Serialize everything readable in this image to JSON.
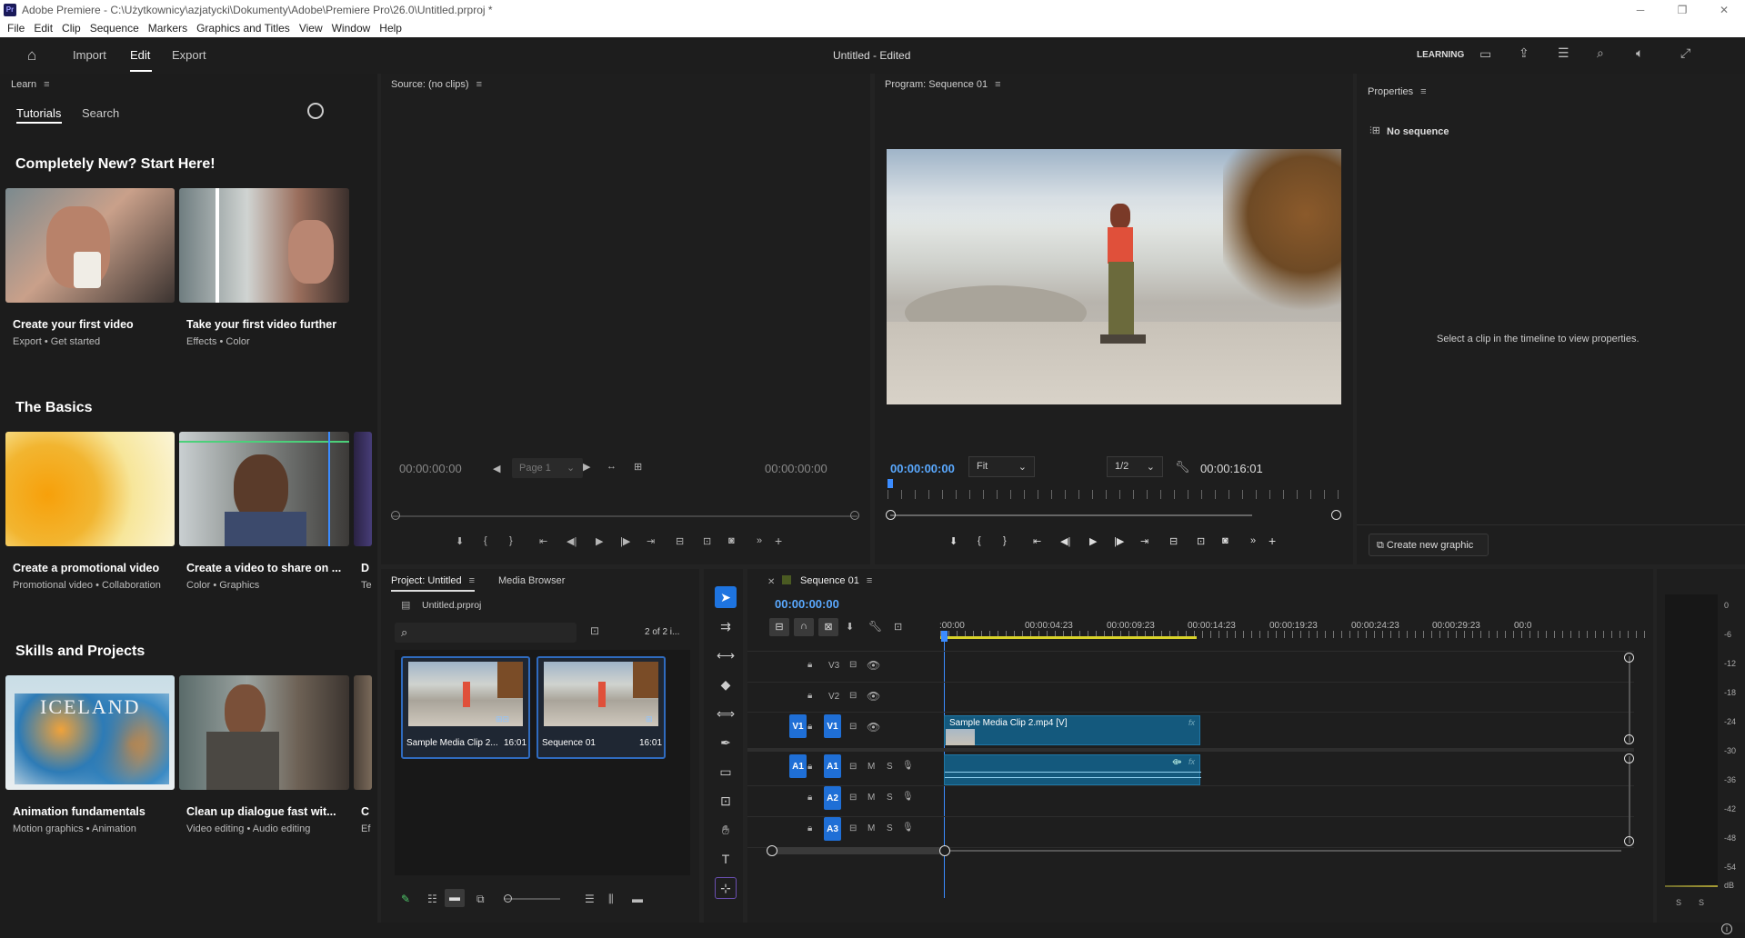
{
  "os_title": "Adobe Premiere - C:\\Użytkownicy\\azjatycki\\Dokumenty\\Adobe\\Premiere Pro\\26.0\\Untitled.prproj *",
  "menu": [
    "File",
    "Edit",
    "Clip",
    "Sequence",
    "Markers",
    "Graphics and Titles",
    "View",
    "Window",
    "Help"
  ],
  "header": {
    "nav": [
      "Import",
      "Edit",
      "Export"
    ],
    "active": "Edit",
    "project_status": "Untitled - Edited",
    "workspace": "LEARNING"
  },
  "learn": {
    "title": "Learn",
    "tabs": [
      "Tutorials",
      "Search"
    ],
    "sections": [
      {
        "heading": "Completely New? Start Here!",
        "cards": [
          {
            "title": "Create your first video",
            "sub": "Export  •  Get started"
          },
          {
            "title": "Take your first video further",
            "sub": "Effects  •  Color"
          }
        ]
      },
      {
        "heading": "The Basics",
        "cards": [
          {
            "title": "Create a promotional video",
            "sub": "Promotional video  •  Collaboration"
          },
          {
            "title": "Create a video to share on ...",
            "sub": "Color  •  Graphics"
          },
          {
            "title": "D",
            "sub": "Te"
          }
        ]
      },
      {
        "heading": "Skills and Projects",
        "cards": [
          {
            "title": "Animation fundamentals",
            "sub": "Motion graphics  •  Animation"
          },
          {
            "title": "Clean up dialogue fast wit...",
            "sub": "Video editing  •  Audio editing"
          },
          {
            "title": "C",
            "sub": "Ef"
          }
        ]
      }
    ],
    "iceland_text": "ICELAND"
  },
  "source": {
    "title": "Source: (no clips)",
    "tc_left": "00:00:00:00",
    "tc_right": "00:00:00:00",
    "page": "Page 1"
  },
  "program": {
    "title": "Program: Sequence 01",
    "tc_left": "00:00:00:00",
    "tc_right": "00:00:16:01",
    "fit": "Fit",
    "resolution": "1/2"
  },
  "properties": {
    "title": "Properties",
    "no_sequence": "No sequence",
    "hint": "Select a clip in the timeline to view properties.",
    "create_btn": "Create new graphic"
  },
  "project": {
    "tab_active": "Project: Untitled",
    "tab_other": "Media Browser",
    "file": "Untitled.prproj",
    "count": "2 of 2 i...",
    "items": [
      {
        "name": "Sample Media Clip 2...",
        "duration": "16:01"
      },
      {
        "name": "Sequence 01",
        "duration": "16:01"
      }
    ]
  },
  "timeline": {
    "title": "Sequence 01",
    "tc": "00:00:00:00",
    "ruler": [
      ":00:00",
      "00:00:04:23",
      "00:00:09:23",
      "00:00:14:23",
      "00:00:19:23",
      "00:00:24:23",
      "00:00:29:23",
      "00:0"
    ],
    "video_tracks": [
      "V3",
      "V2",
      "V1"
    ],
    "audio_tracks": [
      "A1",
      "A2",
      "A3"
    ],
    "src_v": "V1",
    "src_a": "A1",
    "clip_label": "Sample Media Clip 2.mp4 [V]",
    "clip_fx": "fx",
    "track_m": "M",
    "track_s": "S"
  },
  "meter": {
    "scale": [
      "0",
      "-6",
      "-12",
      "-18",
      "-24",
      "-30",
      "-36",
      "-42",
      "-48",
      "-54",
      "dB"
    ],
    "solo": [
      "S",
      "S"
    ]
  }
}
